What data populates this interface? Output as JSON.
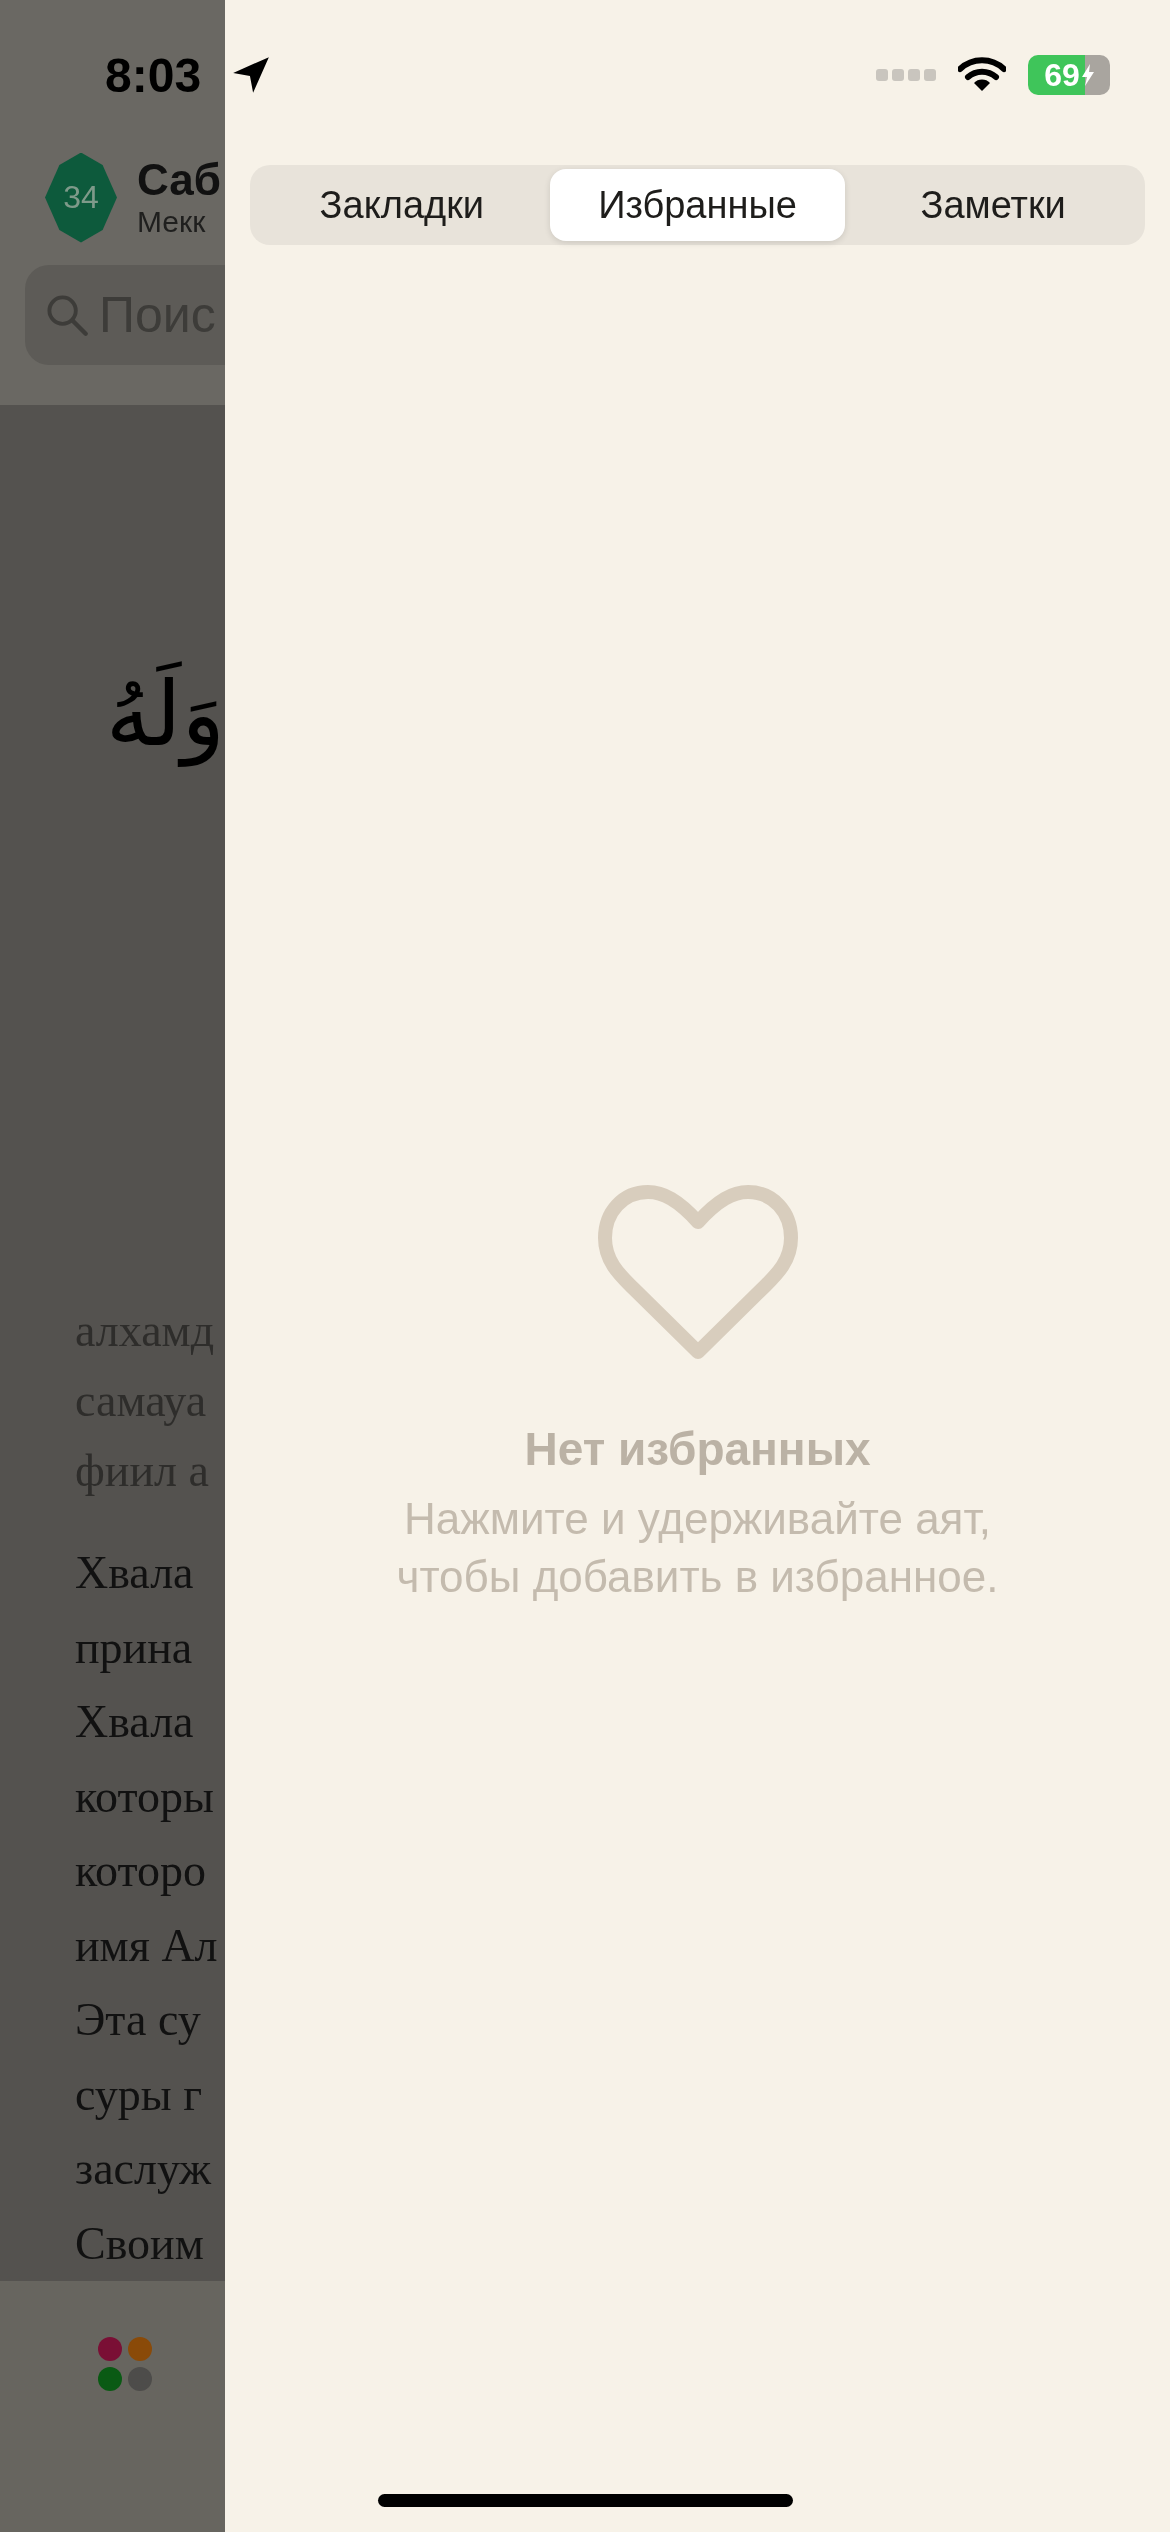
{
  "background_screen": {
    "status_bar": {
      "time": "8:03"
    },
    "header": {
      "badge": "34",
      "title": "Саб",
      "subtitle": "Мекк"
    },
    "search": {
      "placeholder": "Поис"
    },
    "arabic_lines": [
      "وَلَهُ"
    ],
    "transliteration_lines": [
      "алхамд",
      "самауа",
      "фиил а"
    ],
    "translation_lines": [
      "Хвала",
      "прина",
      "Хвала",
      "которы",
      "которо",
      "имя Ал",
      "Эта су",
      "суры г",
      "заслуж",
      "Своим"
    ]
  },
  "status_bar": {
    "battery": "69"
  },
  "tabs": [
    {
      "label": "Закладки",
      "selected": false
    },
    {
      "label": "Избранные",
      "selected": true
    },
    {
      "label": "Заметки",
      "selected": false
    }
  ],
  "empty_state": {
    "title": "Нет избранных",
    "message": "Нажмите и удерживайте аят, чтобы добавить в избранное."
  }
}
